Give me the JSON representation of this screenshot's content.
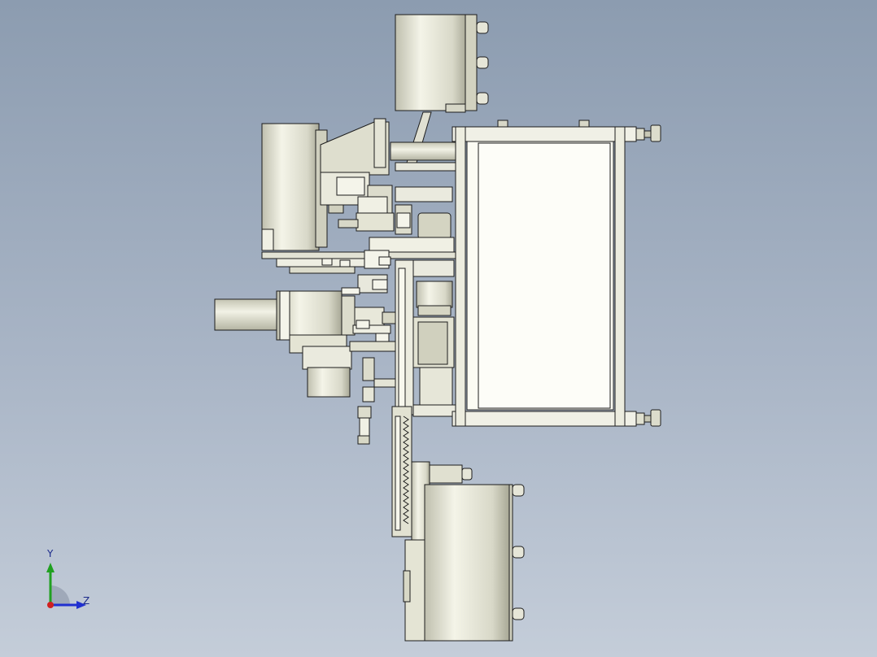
{
  "viewport": {
    "background_top": "#8c9cb0",
    "background_bottom": "#c4cdd9",
    "part_fill": "#e8e8da",
    "part_shade": "#c9c9b8",
    "edge_color": "#1c1c1c"
  },
  "triad": {
    "y_label": "Y",
    "z_label": "Z",
    "x_color": "#d02020",
    "y_color": "#20a020",
    "z_color": "#2030d0"
  }
}
